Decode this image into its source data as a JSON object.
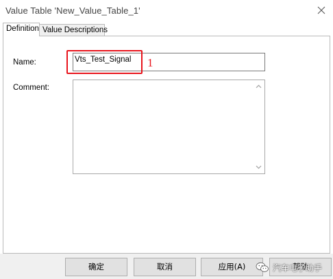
{
  "window": {
    "title": "Value Table 'New_Value_Table_1'",
    "close_icon": "close-icon"
  },
  "tabs": [
    {
      "label": "Definition",
      "active": true
    },
    {
      "label": "Value Descriptions",
      "active": false
    }
  ],
  "form": {
    "name_label": "Name:",
    "name_value": "Vts_Test_Signal",
    "comment_label": "Comment:",
    "comment_value": ""
  },
  "annotation": {
    "number": "1",
    "color": "#e8131b"
  },
  "buttons": {
    "ok": "确定",
    "cancel": "取消",
    "apply": "应用(A)",
    "help": "帮助"
  },
  "watermark": {
    "text": "汽车电子助手",
    "icon": "wechat-icon"
  }
}
